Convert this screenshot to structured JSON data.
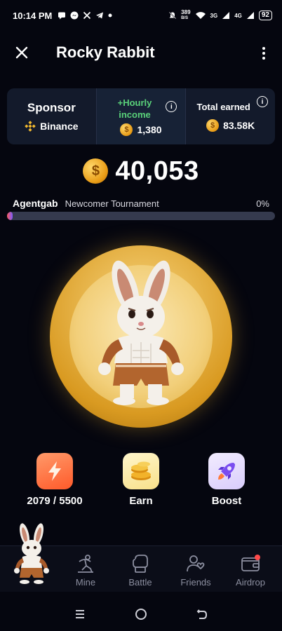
{
  "status_bar": {
    "time": "10:14 PM",
    "notification_icons": [
      "chat-icon",
      "messenger-icon",
      "x-icon",
      "telegram-icon",
      "dot-icon"
    ],
    "net_speed": "389",
    "net_speed_unit": "B/S",
    "signal_1": "3G",
    "signal_2": "4G",
    "battery": "92"
  },
  "header": {
    "title": "Rocky Rabbit",
    "close_icon": "close-icon",
    "menu_icon": "more-vertical-icon"
  },
  "stats": {
    "sponsor_label": "Sponsor",
    "sponsor_name": "Binance",
    "hourly_label": "+Hourly income",
    "hourly_value": "1,380",
    "total_label": "Total earned",
    "total_value": "83.58K"
  },
  "balance": {
    "value": "40,053"
  },
  "tournament": {
    "username": "Agentgab",
    "name": "Newcomer Tournament",
    "percent": "0%",
    "progress_fraction": 0.02
  },
  "actions": [
    {
      "label": "2079 / 5500",
      "icon": "lightning-icon"
    },
    {
      "label": "Earn",
      "icon": "coins-icon"
    },
    {
      "label": "Boost",
      "icon": "rocket-icon"
    }
  ],
  "nav": [
    {
      "label": "Mine",
      "icon": "mine-icon"
    },
    {
      "label": "Battle",
      "icon": "boxing-glove-icon"
    },
    {
      "label": "Friends",
      "icon": "friends-icon"
    },
    {
      "label": "Airdrop",
      "icon": "wallet-icon"
    }
  ],
  "colors": {
    "background": "#05060f",
    "card": "#131a2b",
    "accent_green": "#5ad27a",
    "gold": "#e99c16",
    "progress_track": "#353a4e"
  }
}
